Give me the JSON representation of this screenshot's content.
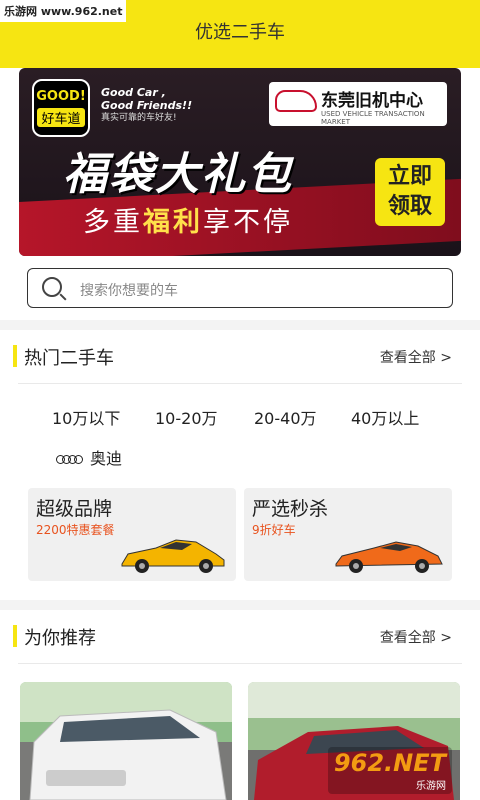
{
  "watermark": {
    "top_left": "乐游网 www.962.net",
    "bottom_right_brand": "962.NET",
    "bottom_right_sub": "乐游网"
  },
  "app": {
    "title": "优选二手车"
  },
  "banner": {
    "logo_good": "GOOD!",
    "logo_cn": "好车道",
    "slogan_line1": "Good Car ,",
    "slogan_line2": "Good Friends!!",
    "slogan_cn": "真实可靠的车好友!",
    "brand_name": "东莞旧机中心",
    "brand_en": "USED VEHICLE TRANSACTION MARKET",
    "headline": "福袋大礼包",
    "sub_prefix": "多重",
    "sub_highlight": "福利",
    "sub_suffix": "享不停",
    "cta_line1": "立即",
    "cta_line2": "领取",
    "colors": {
      "bg": "#1a1219",
      "accent": "#f6e512",
      "red": "#b8162a"
    }
  },
  "search": {
    "placeholder": "搜索你想要的车",
    "icon": "search-icon"
  },
  "hot_section": {
    "title": "热门二手车",
    "more": "查看全部 >",
    "price_filters": [
      "10万以下",
      "10-20万",
      "20-40万",
      "40万以上"
    ],
    "brand_filter": "奥迪",
    "promos": [
      {
        "title": "超级品牌",
        "subtitle": "2200特惠套餐",
        "car_color": "#f4b400"
      },
      {
        "title": "严选秒杀",
        "subtitle": "9折好车",
        "car_color": "#f06a1a"
      }
    ]
  },
  "recommend_section": {
    "title": "为你推荐",
    "more": "查看全部 >"
  },
  "colors": {
    "accent": "#f6e512",
    "promo_subtitle": "#e8531f"
  }
}
